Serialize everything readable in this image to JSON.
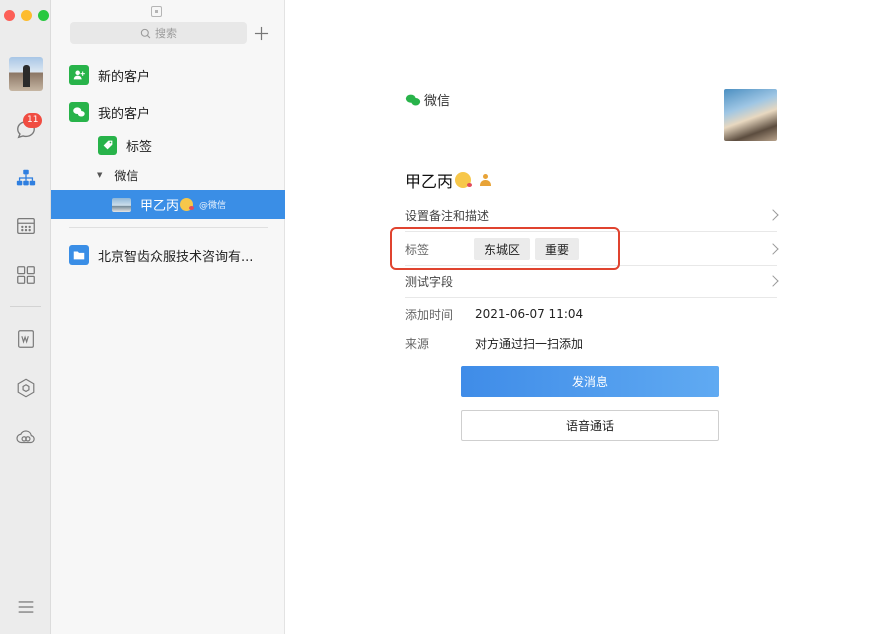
{
  "rail": {
    "unread_badge": "11",
    "icons": [
      "chat-icon",
      "org-chart-icon",
      "calendar-icon",
      "apps-grid-icon",
      "document-icon",
      "cube-icon",
      "cloud-icon",
      "menu-icon"
    ]
  },
  "list": {
    "search_placeholder": "搜索",
    "items": {
      "new_customers": "新的客户",
      "my_customers": "我的客户",
      "tags": "标签",
      "wechat_group": "微信",
      "selected_contact": "甲乙丙",
      "selected_contact_suffix": "@微信",
      "department": "北京智齿众服技术咨询有..."
    }
  },
  "detail": {
    "source_channel": "微信",
    "name": "甲乙丙",
    "remark_row": "设置备注和描述",
    "tags_label": "标签",
    "tags": [
      "东城区",
      "重要"
    ],
    "custom_field_row": "测试字段",
    "added_time_label": "添加时间",
    "added_time_value": "2021-06-07 11:04",
    "source_label": "来源",
    "source_value": "对方通过扫一扫添加",
    "send_message_button": "发消息",
    "voice_call_button": "语音通话"
  },
  "colors": {
    "accent_blue": "#3a8ee6",
    "highlight_red": "#e0432f",
    "wechat_green": "#28b34a",
    "badge_red": "#f04c41"
  }
}
